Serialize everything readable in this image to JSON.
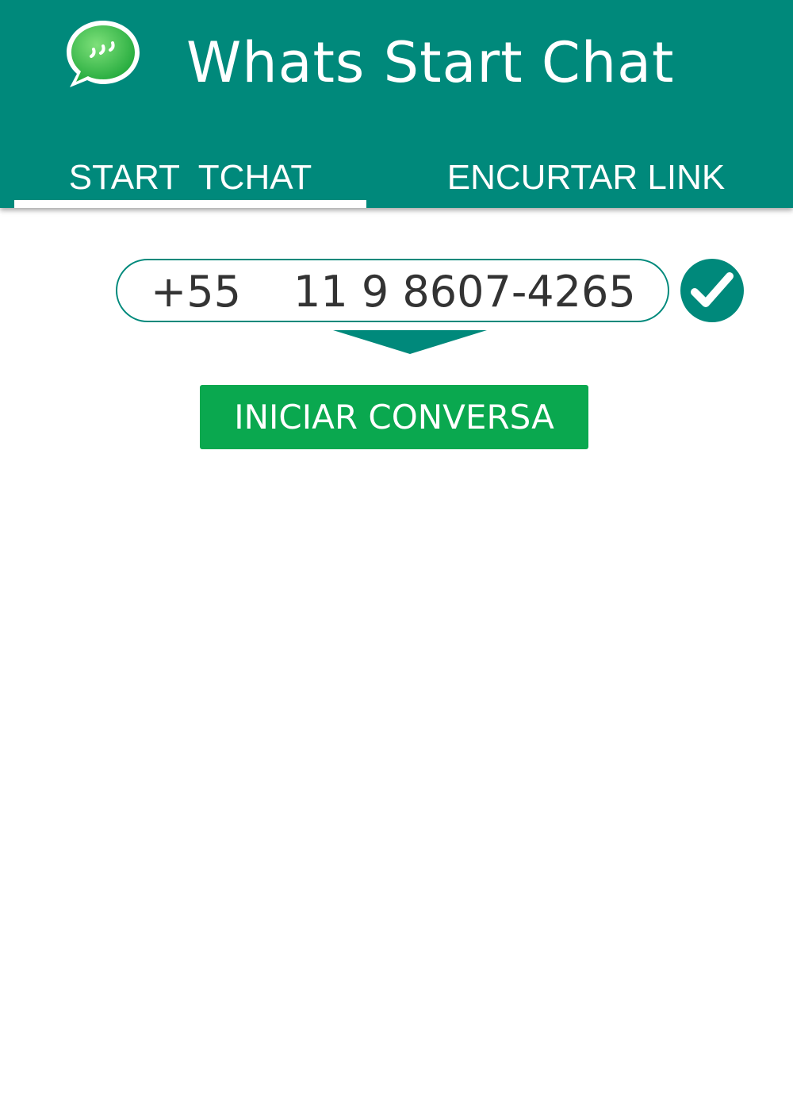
{
  "app": {
    "title": "Whats Start Chat",
    "logo_icon": "whatsapp-chat-bubble-icon"
  },
  "tabs": [
    {
      "label": "START  TCHAT",
      "active": true
    },
    {
      "label": "ENCURTAR LINK",
      "active": false
    }
  ],
  "form": {
    "country_code": "+55",
    "phone_number": "11 9 8607-4265",
    "confirm_icon": "checkmark-icon",
    "dropdown_icon": "chevron-down-icon",
    "start_button_label": "INICIAR CONVERSA"
  },
  "colors": {
    "primary": "#00897b",
    "button": "#0aa84f",
    "text": "#333333"
  }
}
